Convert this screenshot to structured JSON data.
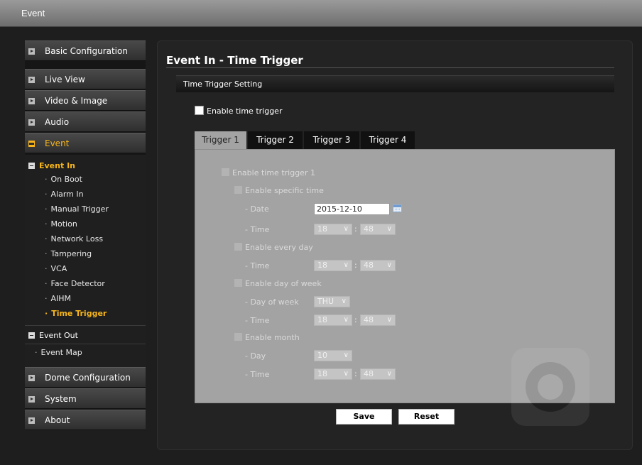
{
  "topbar": {
    "title": "Event"
  },
  "sidebar": {
    "basic_configuration": "Basic Configuration",
    "live_view": "Live View",
    "video_image": "Video & Image",
    "audio": "Audio",
    "event": "Event",
    "event_in": "Event In",
    "event_in_items": [
      "On Boot",
      "Alarm In",
      "Manual Trigger",
      "Motion",
      "Network Loss",
      "Tampering",
      "VCA",
      "Face Detector",
      "AIHM",
      "Time Trigger"
    ],
    "event_out": "Event Out",
    "event_map": "Event Map",
    "dome_configuration": "Dome Configuration",
    "system": "System",
    "about": "About",
    "active_item": "Time Trigger"
  },
  "main": {
    "title": "Event In - Time Trigger",
    "section_title": "Time Trigger Setting",
    "enable_time_trigger_label": "Enable time trigger",
    "tabs": [
      "Trigger 1",
      "Trigger 2",
      "Trigger 3",
      "Trigger 4"
    ],
    "active_tab": "Trigger 1",
    "panel": {
      "enable_trigger_label": "Enable time trigger 1",
      "specific_time": {
        "label": "Enable specific time",
        "date_label": "- Date",
        "date_value": "2015-12-10",
        "time_label": "- Time",
        "hour": "18",
        "minute": "48"
      },
      "every_day": {
        "label": "Enable every day",
        "time_label": "- Time",
        "hour": "18",
        "minute": "48"
      },
      "day_of_week": {
        "label": "Enable day of week",
        "dow_label": "- Day of week",
        "dow_value": "THU",
        "time_label": "- Time",
        "hour": "18",
        "minute": "48"
      },
      "month": {
        "label": "Enable month",
        "day_label": "- Day",
        "day_value": "10",
        "time_label": "- Time",
        "hour": "18",
        "minute": "48"
      },
      "colon": ":"
    },
    "buttons": {
      "save": "Save",
      "reset": "Reset"
    }
  },
  "icons": {
    "menu_arrow": "arrow-right-square-icon",
    "calendar": "calendar-icon",
    "dropdown": "chevron-down-icon"
  }
}
